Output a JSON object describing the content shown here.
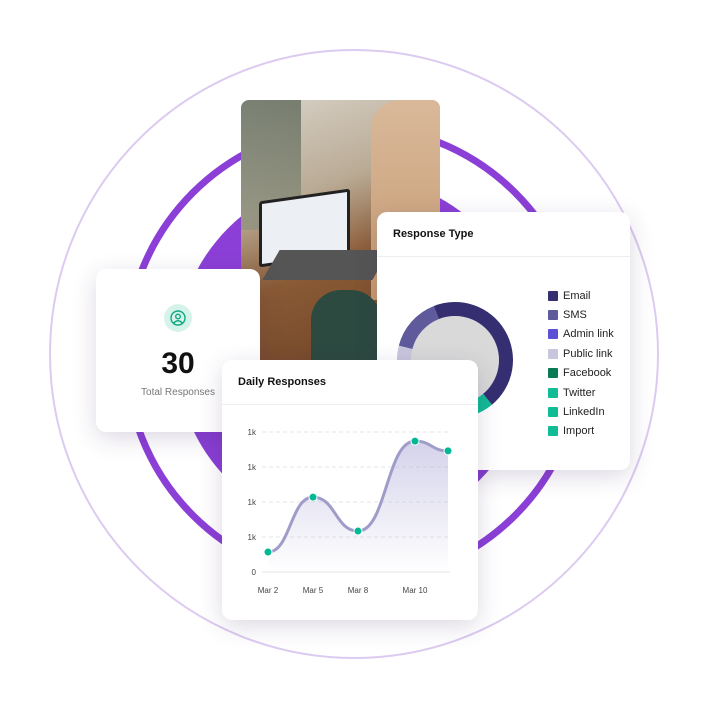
{
  "colors": {
    "ring_outer": "#dccbf0",
    "ring_mid": "#8b3fd6",
    "disc": "#8b3fd6",
    "accent": "#00b894",
    "line": "#9f9cc9"
  },
  "total_card": {
    "icon": "user-circle-icon",
    "value": "30",
    "label": "Total Responses"
  },
  "photo": {
    "description_icon": "laptop-photo"
  },
  "response_type": {
    "title": "Response Type",
    "legend": [
      {
        "label": "Email",
        "color": "#352f72"
      },
      {
        "label": "SMS",
        "color": "#5e5a9c"
      },
      {
        "label": "Admin link",
        "color": "#5a4fd6"
      },
      {
        "label": "Public link",
        "color": "#c8c6de"
      },
      {
        "label": "Facebook",
        "color": "#0a7a55"
      },
      {
        "label": "Twitter",
        "color": "#10bb96"
      },
      {
        "label": "LinkedIn",
        "color": "#10bb96"
      },
      {
        "label": "Import",
        "color": "#10bb96"
      }
    ]
  },
  "chart_data": {
    "type": "area",
    "title": "Daily Responses",
    "y_tick_labels": [
      "0",
      "1k",
      "1k",
      "1k",
      "1k"
    ],
    "x_tick_labels": [
      "Mar 2",
      "Mar 5",
      "Mar 8",
      "Mar 10"
    ],
    "points": [
      {
        "x": "Mar 2",
        "y": 0.57
      },
      {
        "x": "Mar 5",
        "y": 2.14
      },
      {
        "x": "Mar 8",
        "y": 1.17
      },
      {
        "x": "Mar 10",
        "y": 3.74
      },
      {
        "x": "",
        "y": 3.46
      }
    ],
    "ylim": [
      0,
      4
    ],
    "grid": true
  },
  "donut_data": {
    "type": "pie",
    "slices": [
      {
        "label": "Email",
        "value": 45,
        "color": "#352f72"
      },
      {
        "label": "Twitter",
        "value": 12,
        "color": "#10bb96"
      },
      {
        "label": "Facebook",
        "value": 8,
        "color": "#0a7a55"
      },
      {
        "label": "Public link",
        "value": 20,
        "color": "#c8c6de"
      },
      {
        "label": "SMS",
        "value": 15,
        "color": "#5e5a9c"
      }
    ]
  }
}
